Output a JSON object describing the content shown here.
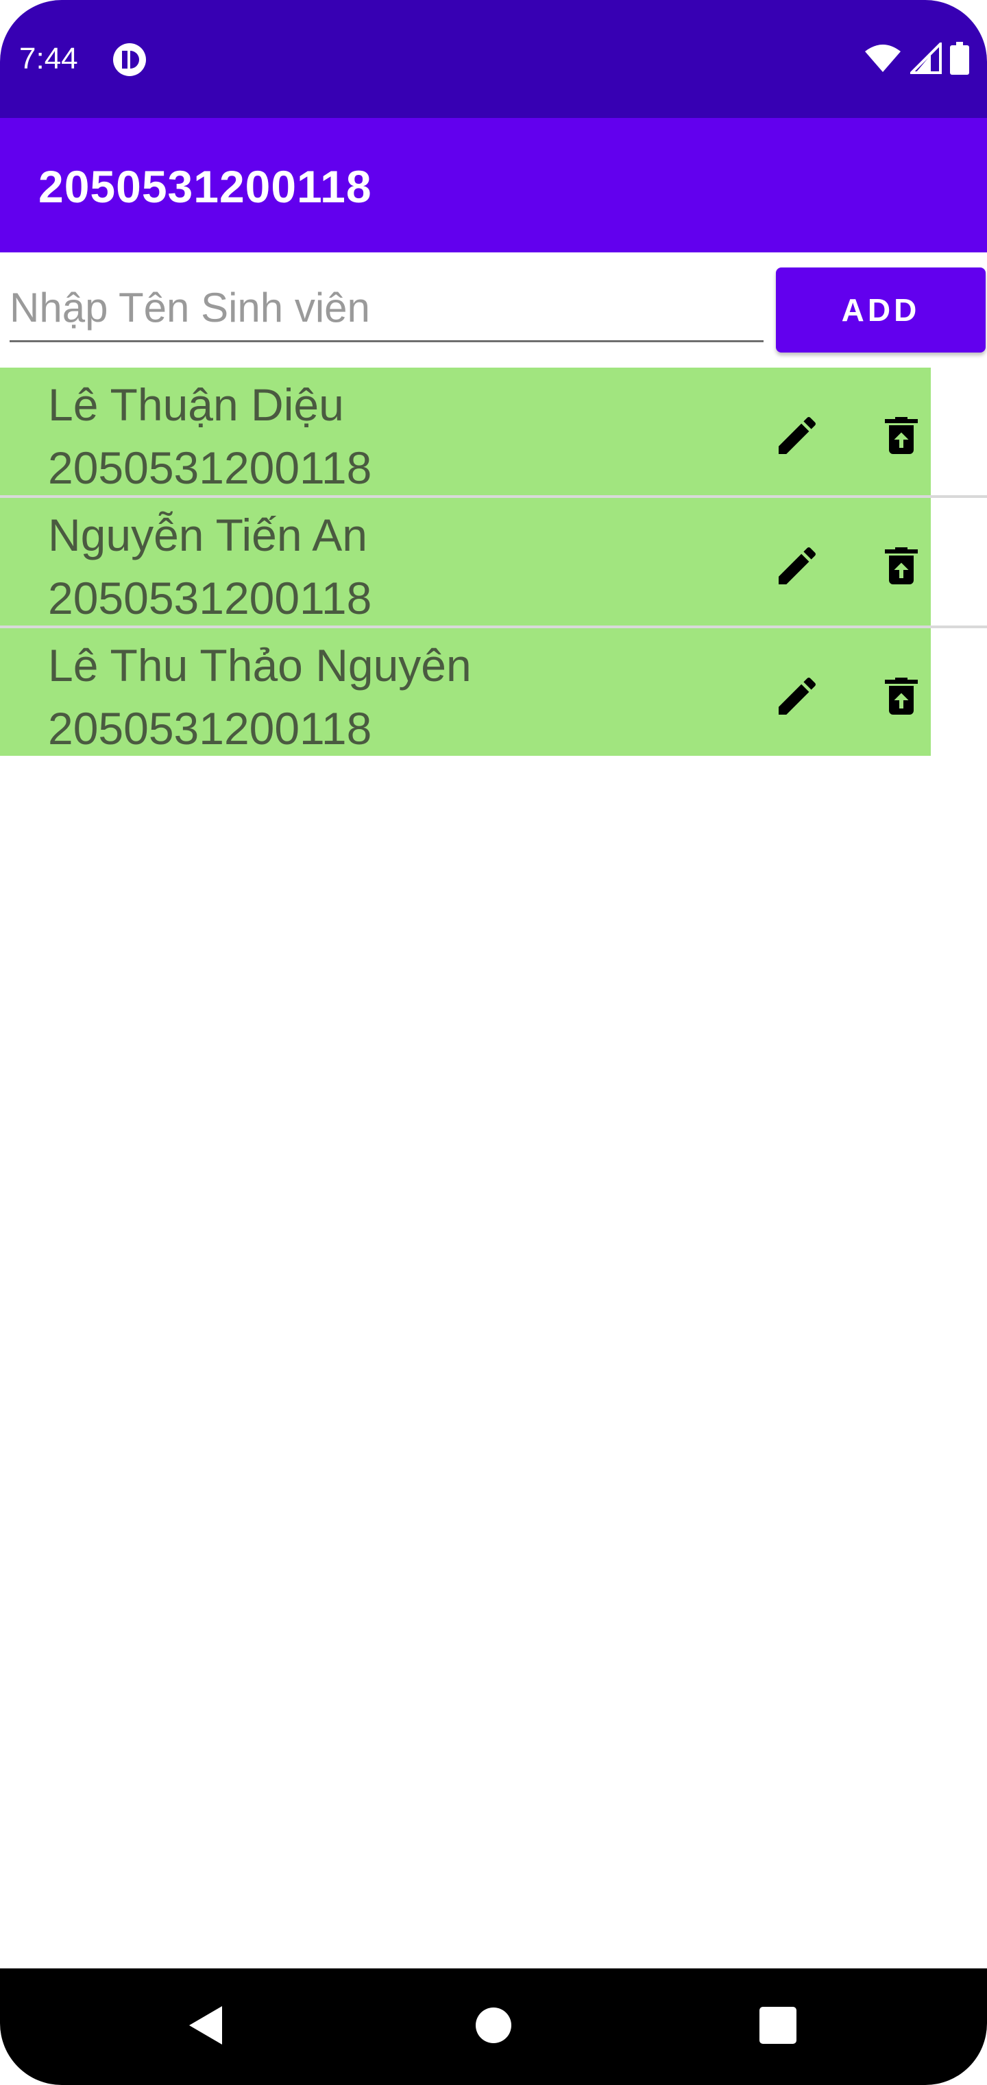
{
  "status_bar": {
    "time": "7:44",
    "icons": [
      "notification-app-icon",
      "wifi-icon",
      "signal-icon",
      "battery-icon"
    ]
  },
  "app_bar": {
    "title": "2050531200118"
  },
  "form": {
    "input_placeholder": "Nhập Tên Sinh viên",
    "input_value": "",
    "add_label": "ADD"
  },
  "students": [
    {
      "name": "Lê Thuận Diệu",
      "id": "2050531200118"
    },
    {
      "name": "Nguyễn Tiến An",
      "id": "2050531200118"
    },
    {
      "name": "Lê Thu Thảo Nguyên",
      "id": "2050531200118"
    }
  ],
  "row_actions": [
    "edit-icon",
    "delete-icon"
  ],
  "colors": {
    "status_bar": "#3700b3",
    "app_bar": "#6200ee",
    "row_background": "#a1e57f",
    "nav_bar": "#000000"
  },
  "nav_bar": {
    "buttons": [
      "back-icon",
      "home-icon",
      "recents-icon"
    ]
  }
}
